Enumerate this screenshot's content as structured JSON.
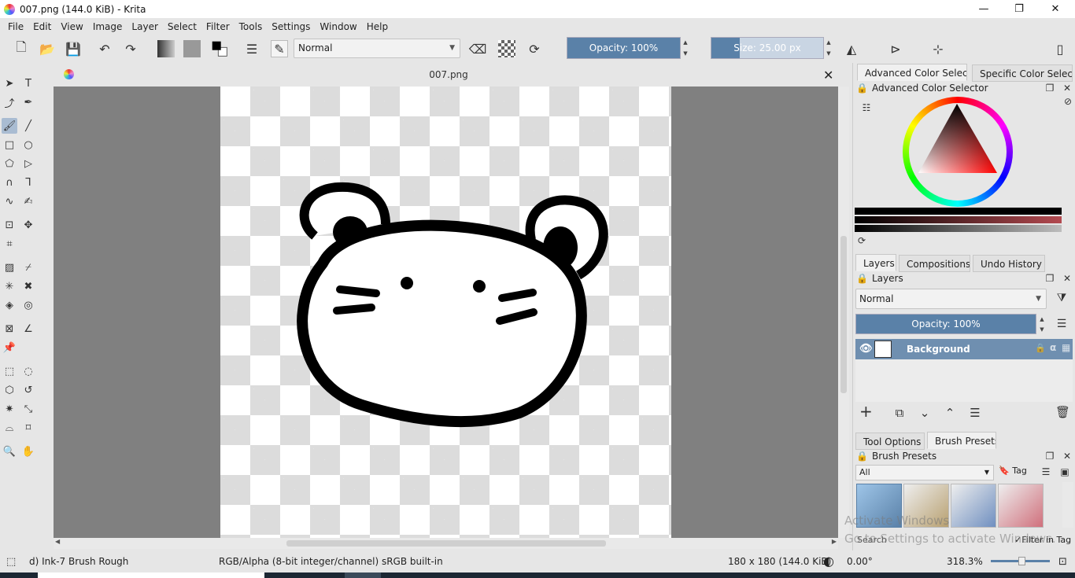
{
  "window": {
    "title": "007.png (144.0 KiB)  - Krita",
    "minimize_glyph": "—",
    "maximize_glyph": "❐",
    "close_glyph": "✕"
  },
  "menu": [
    "File",
    "Edit",
    "View",
    "Image",
    "Layer",
    "Select",
    "Filter",
    "Tools",
    "Settings",
    "Window",
    "Help"
  ],
  "toolbar": {
    "blend_mode": "Normal",
    "opacity_label": "Opacity: 100%",
    "opacity_value": 1.0,
    "size_label": "Size: 25.00 px",
    "size_fill": 0.25
  },
  "document": {
    "tab_title": "007.png"
  },
  "dockers": {
    "color_tabs": [
      "Advanced Color Selec...",
      "Specific Color Selec..."
    ],
    "color_title": "Advanced Color Selector",
    "layer_tabs": [
      "Layers",
      "Compositions",
      "Undo History"
    ],
    "layers_title": "Layers",
    "layer_blend": "Normal",
    "layer_opacity": "Opacity:  100%",
    "layers": [
      {
        "name": "Background"
      }
    ],
    "bottom_tabs": [
      "Tool Options",
      "Brush Presets"
    ],
    "presets_title": "Brush Presets",
    "preset_filter": "All",
    "preset_tag": "Tag",
    "filter_in_tag": "Filter in Tag",
    "search": "Search"
  },
  "status": {
    "brush": "d) Ink-7 Brush Rough",
    "color_space": "RGB/Alpha (8-bit integer/channel)  sRGB built-in",
    "dimensions": "180 x 180 (144.0 KiB)",
    "rotation": "0.00°",
    "zoom": "318.3%"
  },
  "watermark": {
    "line1": "Activate Windows",
    "line2": "Go to Settings to activate Windows."
  },
  "colors": {
    "accent": "#5a81a8",
    "layer_selected": "#6f8fb0",
    "canvas_bg": "#808080"
  }
}
